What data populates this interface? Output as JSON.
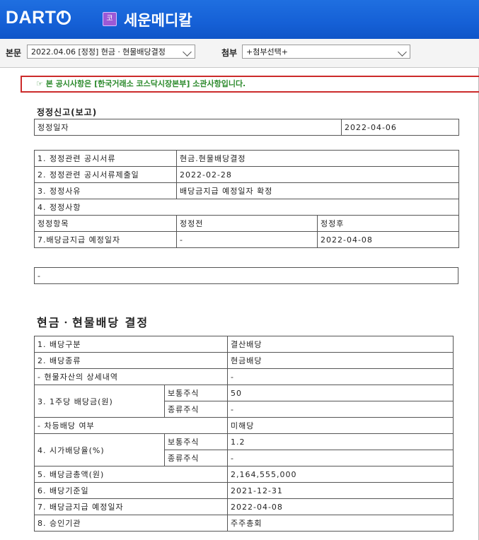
{
  "header": {
    "logo": "DART",
    "badge": "코",
    "company": "세운메디칼"
  },
  "toolbar": {
    "main_label": "본문",
    "main_select": "2022.04.06 [정정] 현금ㆍ현물배당결정",
    "attach_label": "첨부",
    "attach_select": "+첨부선택+"
  },
  "notice": "☞ 본 공시사항은 [한국거래소 코스닥시장본부] 소관사항입니다.",
  "correction": {
    "title": "정정신고(보고)",
    "date_label": "정정일자",
    "date_value": "2022-04-06",
    "rows": [
      {
        "label": "1. 정정관련 공시서류",
        "value": "현금.현물배당결정"
      },
      {
        "label": "2. 정정관련 공시서류제출일",
        "value": "2022-02-28"
      },
      {
        "label": "3. 정정사유",
        "value": "배당금지급 예정일자 확정"
      }
    ],
    "item4": "4. 정정사항",
    "col_item": "정정항목",
    "col_before": "정정전",
    "col_after": "정정후",
    "change_item": "7.배당금지급 예정일자",
    "change_before": "-",
    "change_after": "2022-04-08",
    "remark": "-"
  },
  "dividend": {
    "title": "현금ㆍ현물배당 결정",
    "r1_label": "1. 배당구분",
    "r1_value": "결산배당",
    "r2_label": "2. 배당종류",
    "r2_value": "현금배당",
    "r3_label": "- 현물자산의 상세내역",
    "r3_value": "-",
    "r4_label": "3. 1주당 배당금(원)",
    "common": "보통주식",
    "preferred": "종류주식",
    "r4_common": "50",
    "r4_pref": "-",
    "r5_label": "- 차등배당 여부",
    "r5_value": "미해당",
    "r6_label": "4. 시가배당율(%)",
    "r6_common": "1.2",
    "r6_pref": "-",
    "r7_label": "5. 배당금총액(원)",
    "r7_value": "2,164,555,000",
    "r8_label": "6. 배당기준일",
    "r8_value": "2021-12-31",
    "r9_label": "7. 배당금지급 예정일자",
    "r9_value": "2022-04-08",
    "r10_label": "8. 승인기관",
    "r10_value": "주주총회"
  }
}
